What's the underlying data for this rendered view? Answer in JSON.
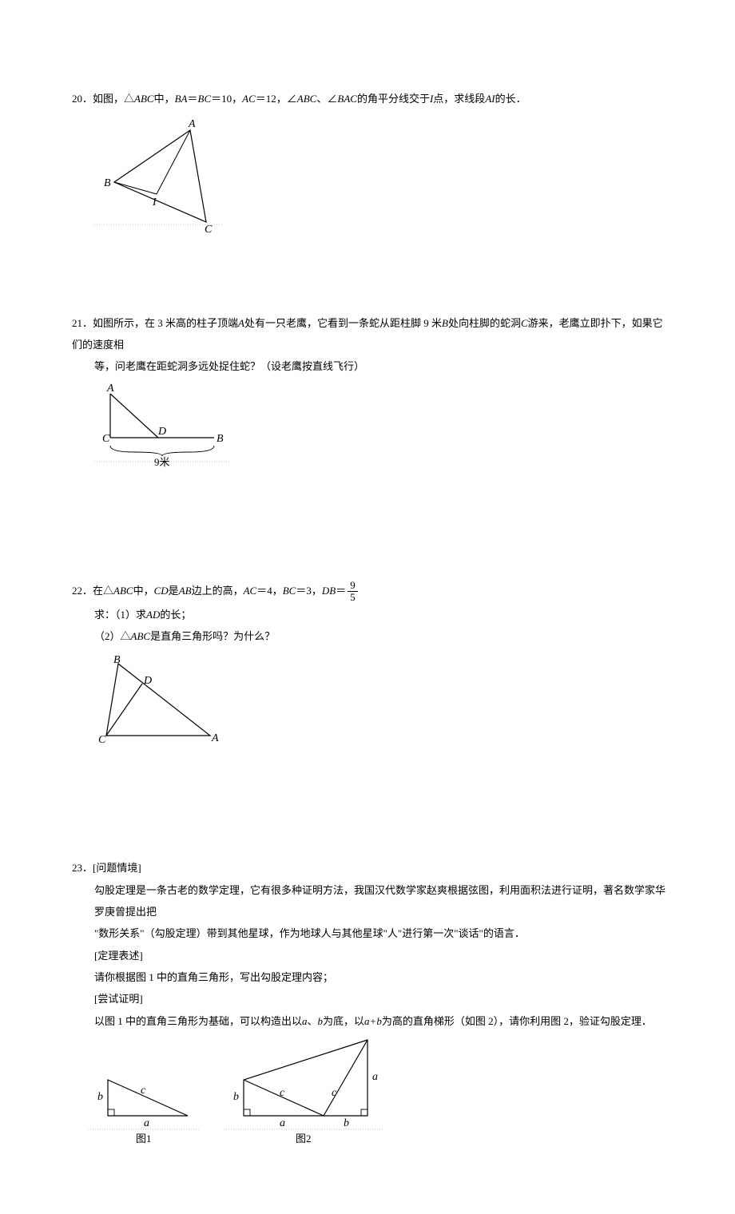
{
  "p20": {
    "num": "20．",
    "text_a": "如图，△",
    "abc_1": "ABC",
    "text_b": "中，",
    "ba": "BA",
    "eq1": "＝",
    "bc": "BC",
    "eq2": "＝10，",
    "ac": "AC",
    "eq3": "＝12，∠",
    "abc_2": "ABC",
    "text_c": "、∠",
    "bac": "BAC",
    "text_d": "的角平分线交于",
    "i": "I",
    "text_e": "点，求线段",
    "ai": "AI",
    "text_f": "的长．",
    "fig": {
      "A": "A",
      "B": "B",
      "C": "C",
      "I": "I"
    }
  },
  "p21": {
    "num": "21．",
    "text_a": "如图所示，在 3 米高的柱子顶端",
    "a": "A",
    "text_b": "处有一只老鹰，它看到一条蛇从距柱脚 9 米",
    "b": "B",
    "text_c": "处向柱脚的蛇洞",
    "c": "C",
    "text_d": "游来，老鹰立即扑下，如果它们的速度相",
    "text_e": "等，问老鹰在距蛇洞多远处捉住蛇？（设老鹰按直线飞行）",
    "fig": {
      "A": "A",
      "B": "B",
      "C": "C",
      "D": "D",
      "nine": "9米"
    }
  },
  "p22": {
    "num": "22．",
    "text_a": "在△",
    "abc": "ABC",
    "text_b": "中，",
    "cd": "CD",
    "text_c": "是",
    "ab": "AB",
    "text_d": "边上的高，",
    "ac": "AC",
    "eq1": "＝4，",
    "bc": "BC",
    "eq2": "＝3，",
    "db": "DB",
    "eq3": "＝",
    "frac_num": "9",
    "frac_den": "5",
    "q_label": "求：",
    "q1": "（1）求",
    "ad": "AD",
    "q1b": "的长；",
    "q2a": "（2）△",
    "abc2": "ABC",
    "q2b": "是直角三角形吗？为什么？",
    "fig": {
      "A": "A",
      "B": "B",
      "C": "C",
      "D": "D"
    }
  },
  "p23": {
    "num": "23．",
    "h1": "[问题情境]",
    "para1": "勾股定理是一条古老的数学定理，它有很多种证明方法，我国汉代数学家赵爽根据弦图，利用面积法进行证明，著名数学家华罗庚曾提出把",
    "para1b": "\"数形关系\"（勾股定理）带到其他星球，作为地球人与其他星球\"人\"进行第一次\"谈话\"的语言．",
    "h2": "[定理表述]",
    "para2": "请你根据图 1 中的直角三角形，写出勾股定理内容；",
    "h3": "[尝试证明]",
    "para3a": "以图 1 中的直角三角形为基础，可以构造出以",
    "a": "a",
    "para3b": "、",
    "b": "b",
    "para3c": "为底，以",
    "ab": "a+b",
    "para3d": "为高的直角梯形（如图 2），请你利用图 2，验证勾股定理．",
    "fig": {
      "a": "a",
      "b": "b",
      "c": "c",
      "cap1": "图1",
      "cap2": "图2"
    }
  }
}
